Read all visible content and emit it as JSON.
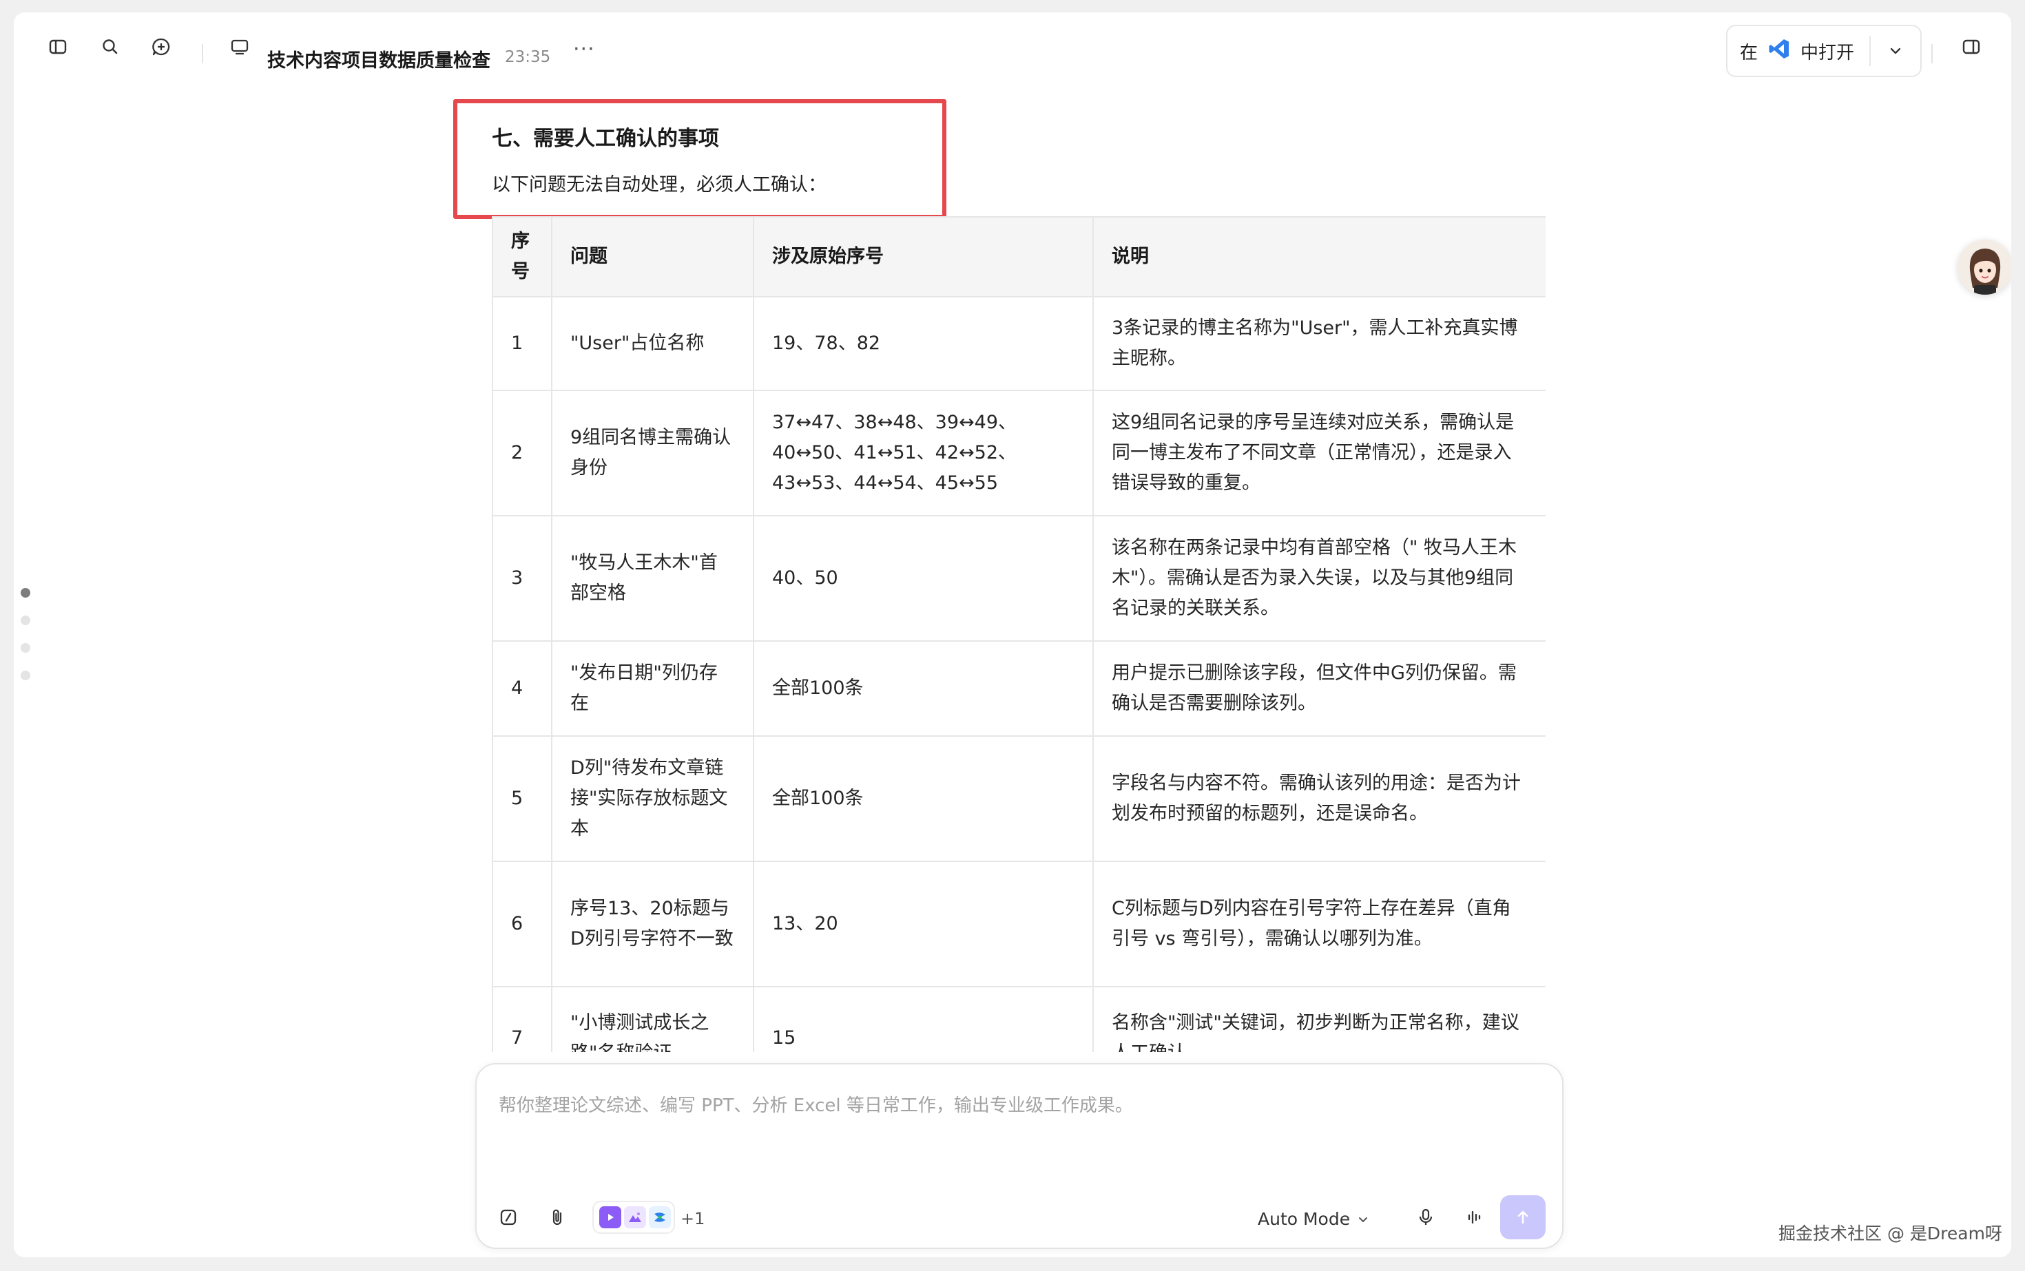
{
  "topbar": {
    "title": "技术内容项目数据质量检查",
    "time": "23:35",
    "more": "···",
    "open_prefix": "在",
    "open_suffix": "中打开"
  },
  "section": {
    "title": "七、需要人工确认的事项",
    "intro": "以下问题无法自动处理，必须人工确认："
  },
  "table": {
    "headers": [
      "序号",
      "问题",
      "涉及原始序号",
      "说明"
    ],
    "rows": [
      [
        "1",
        "\"User\"占位名称",
        "19、78、82",
        "3条记录的博主名称为\"User\"，需人工补充真实博主昵称。"
      ],
      [
        "2",
        "9组同名博主需确认身份",
        "37↔47、38↔48、39↔49、40↔50、41↔51、42↔52、43↔53、44↔54、45↔55",
        "这9组同名记录的序号呈连续对应关系，需确认是同一博主发布了不同文章（正常情况），还是录入错误导致的重复。"
      ],
      [
        "3",
        "\"牧马人王木木\"首部空格",
        "40、50",
        "该名称在两条记录中均有首部空格（\" 牧马人王木木\"）。需确认是否为录入失误，以及与其他9组同名记录的关联关系。"
      ],
      [
        "4",
        "\"发布日期\"列仍存在",
        "全部100条",
        "用户提示已删除该字段，但文件中G列仍保留。需确认是否需要删除该列。"
      ],
      [
        "5",
        "D列\"待发布文章链接\"实际存放标题文本",
        "全部100条",
        "字段名与内容不符。需确认该列的用途：是否为计划发布时预留的标题列，还是误命名。"
      ],
      [
        "6",
        "序号13、20标题与D列引号字符不一致",
        "13、20",
        "C列标题与D列内容在引号字符上存在差异（直角引号 vs 弯引号），需确认以哪列为准。"
      ],
      [
        "7",
        "\"小博测试成长之路\"名称验证",
        "15",
        "名称含\"测试\"关键词，初步判断为正常名称，建议人工确认。"
      ]
    ]
  },
  "chat": {
    "placeholder": "帮你整理论文综述、编写 PPT、分析 Excel 等日常工作，输出专业级工作成果。",
    "apps_more": "+1",
    "mode": "Auto Mode"
  },
  "watermark": "掘金技术社区 @ 是Dream呀",
  "colors": {
    "highlight": "#e5484d",
    "send_button": "#c9c7fb",
    "vscode_blue": "#2f80ed"
  }
}
